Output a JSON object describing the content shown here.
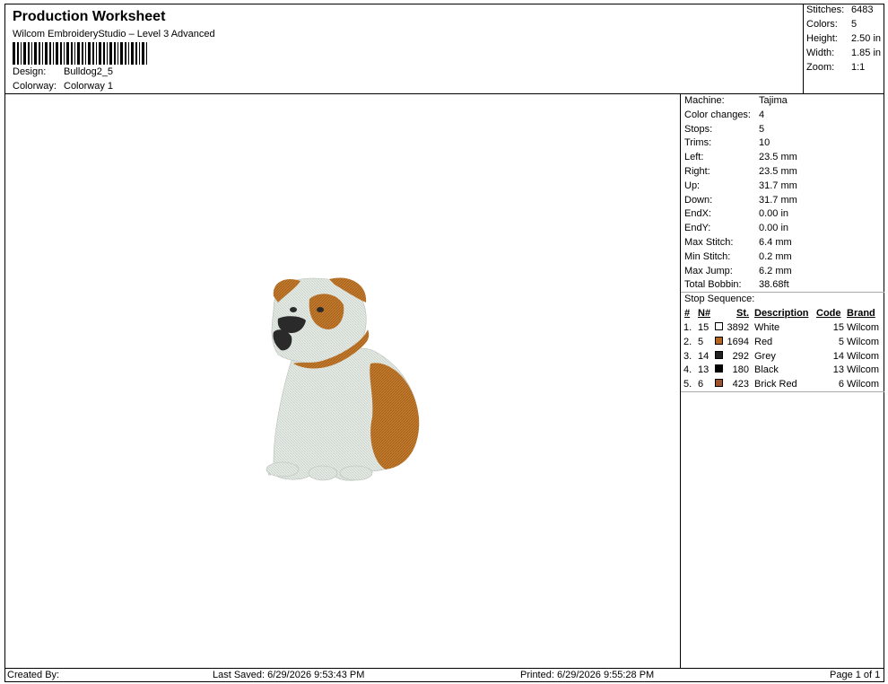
{
  "header": {
    "title": "Production Worksheet",
    "subtitle": "Wilcom EmbroideryStudio – Level 3 Advanced",
    "design_label": "Design:",
    "design_value": "Bulldog2_5",
    "colorway_label": "Colorway:",
    "colorway_value": "Colorway 1"
  },
  "stats": [
    {
      "label": "Stitches:",
      "value": "6483"
    },
    {
      "label": "Colors:",
      "value": "5"
    },
    {
      "label": "Height:",
      "value": "2.50 in"
    },
    {
      "label": "Width:",
      "value": "1.85 in"
    },
    {
      "label": "Zoom:",
      "value": "1:1"
    }
  ],
  "machine_info": [
    {
      "label": "Machine:",
      "value": "Tajima"
    },
    {
      "label": "Color changes:",
      "value": "4"
    },
    {
      "label": "Stops:",
      "value": "5"
    },
    {
      "label": "Trims:",
      "value": "10"
    },
    {
      "label": "Left:",
      "value": "23.5 mm"
    },
    {
      "label": "Right:",
      "value": "23.5 mm"
    },
    {
      "label": "Up:",
      "value": "31.7 mm"
    },
    {
      "label": "Down:",
      "value": "31.7 mm"
    },
    {
      "label": "EndX:",
      "value": "0.00 in"
    },
    {
      "label": "EndY:",
      "value": "0.00 in"
    },
    {
      "label": "Max Stitch:",
      "value": "6.4 mm"
    },
    {
      "label": "Min Stitch:",
      "value": "0.2 mm"
    },
    {
      "label": "Max Jump:",
      "value": "6.2 mm"
    },
    {
      "label": "Total Bobbin:",
      "value": "38.68ft"
    }
  ],
  "stop_sequence": {
    "title": "Stop Sequence:",
    "headers": {
      "num": "#",
      "n": "N#",
      "st": "St.",
      "description": "Description",
      "code": "Code",
      "brand": "Brand"
    },
    "rows": [
      {
        "num": "1.",
        "n": "15",
        "color": "#ffffff",
        "st": "3892",
        "description": "White",
        "code": "15",
        "brand": "Wilcom"
      },
      {
        "num": "2.",
        "n": "5",
        "color": "#b5651d",
        "st": "1694",
        "description": "Red",
        "code": "5",
        "brand": "Wilcom"
      },
      {
        "num": "3.",
        "n": "14",
        "color": "#222222",
        "st": "292",
        "description": "Grey",
        "code": "14",
        "brand": "Wilcom"
      },
      {
        "num": "4.",
        "n": "13",
        "color": "#000000",
        "st": "180",
        "description": "Black",
        "code": "13",
        "brand": "Wilcom"
      },
      {
        "num": "5.",
        "n": "6",
        "color": "#a0522d",
        "st": "423",
        "description": "Brick Red",
        "code": "6",
        "brand": "Wilcom"
      }
    ]
  },
  "footer": {
    "created_by": "Created By:",
    "last_saved": "Last Saved: 6/29/2026 9:53:43 PM",
    "printed": "Printed: 6/29/2026 9:55:28 PM",
    "page": "Page 1 of 1"
  },
  "design_colors": {
    "white": "#e8ede8",
    "brown": "#c47a2c",
    "dark": "#2a2a2a"
  }
}
